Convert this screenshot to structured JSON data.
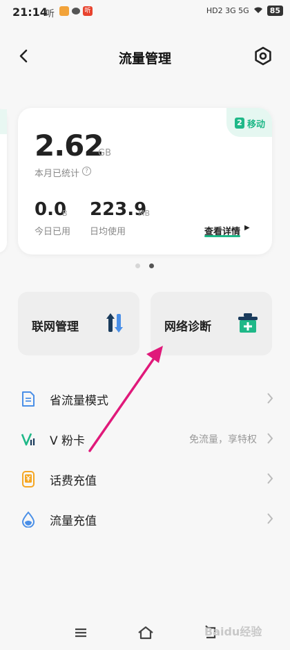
{
  "status": {
    "time": "21:14",
    "app1": "听",
    "app2": "听",
    "network": "HD2  3G  5G",
    "battery": "85"
  },
  "header": {
    "title": "流量管理"
  },
  "card": {
    "carrier_num": "2",
    "carrier_name": "移动",
    "month_value": "2.62",
    "month_unit": "GB",
    "month_label": "本月已统计",
    "today_value": "0.0",
    "today_unit": "B",
    "today_label": "今日已用",
    "avg_value": "223.9",
    "avg_unit": "MB",
    "avg_label": "日均使用",
    "details": "查看详情",
    "carousel_total": 2,
    "carousel_active": 2
  },
  "tiles": [
    {
      "label": "联网管理",
      "icon": "data-transfer-icon"
    },
    {
      "label": "网络诊断",
      "icon": "medical-kit-icon"
    }
  ],
  "list": [
    {
      "label": "省流量模式",
      "sub": "",
      "icon": "document-saver-icon",
      "color": "#4a8fe7"
    },
    {
      "label": "V 粉卡",
      "sub": "免流量，享特权",
      "icon": "v-card-icon",
      "color": "#1fb888"
    },
    {
      "label": "话费充值",
      "sub": "",
      "icon": "yen-recharge-icon",
      "color": "#f5a623"
    },
    {
      "label": "流量充值",
      "sub": "",
      "icon": "water-drop-icon",
      "color": "#4a8fe7"
    }
  ],
  "colors": {
    "accent": "#1fb888",
    "annotation": "#e0197a"
  },
  "watermark": "Baidu经验"
}
